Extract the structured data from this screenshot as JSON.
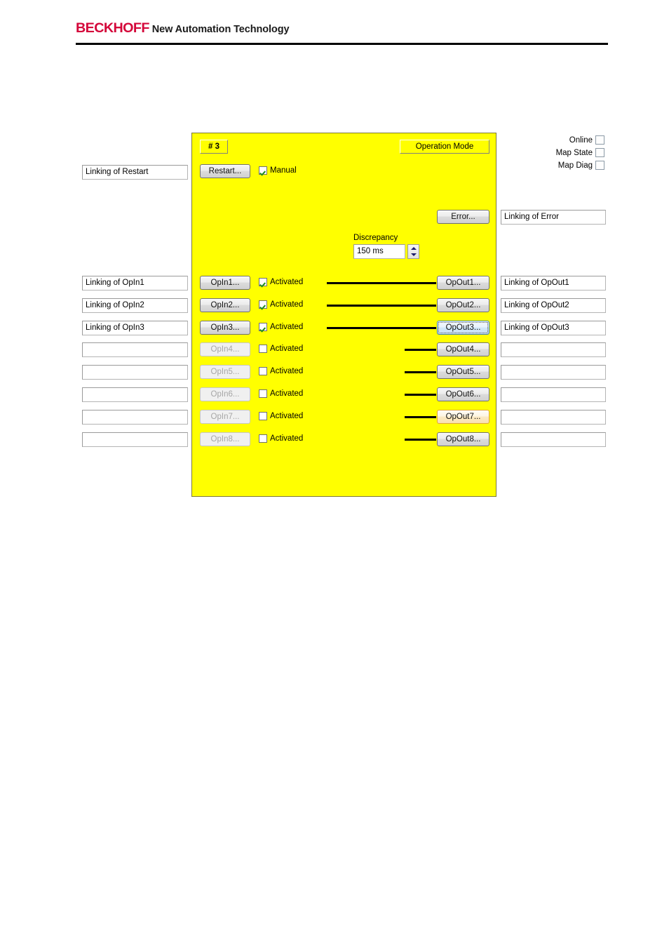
{
  "header": {
    "logo": "BECKHOFF",
    "tagline": "New Automation Technology"
  },
  "panel": {
    "index_tag": "# 3",
    "operation_mode_label": "Operation Mode",
    "restart_button": "Restart...",
    "manual_checkbox_label": "Manual",
    "manual_checked": true,
    "error_button": "Error...",
    "discrepancy_label": "Discrepancy",
    "discrepancy_value": "150 ms",
    "background_color": "#ffff00",
    "border_color": "#7d7a36"
  },
  "status_flags": [
    {
      "label": "Online",
      "checked": false
    },
    {
      "label": "Map State",
      "checked": false
    },
    {
      "label": "Map Diag",
      "checked": false
    }
  ],
  "links": {
    "restart": "Linking of Restart",
    "error": "Linking of Error"
  },
  "rows": [
    {
      "in_link": "Linking of OpIn1",
      "in_button": "OpIn1...",
      "in_enabled": true,
      "activated_label": "Activated",
      "activated": true,
      "connector": "long",
      "out_button": "OpOut1...",
      "out_state": "normal",
      "out_link": "Linking of OpOut1"
    },
    {
      "in_link": "Linking of OpIn2",
      "in_button": "OpIn2...",
      "in_enabled": true,
      "activated_label": "Activated",
      "activated": true,
      "connector": "long",
      "out_button": "OpOut2...",
      "out_state": "normal",
      "out_link": "Linking of OpOut2"
    },
    {
      "in_link": "Linking of OpIn3",
      "in_button": "OpIn3...",
      "in_enabled": true,
      "activated_label": "Activated",
      "activated": true,
      "connector": "long",
      "out_button": "OpOut3...",
      "out_state": "focused",
      "out_link": "Linking of OpOut3"
    },
    {
      "in_link": "",
      "in_button": "OpIn4...",
      "in_enabled": false,
      "activated_label": "Activated",
      "activated": false,
      "connector": "short",
      "out_button": "OpOut4...",
      "out_state": "normal",
      "out_link": ""
    },
    {
      "in_link": "",
      "in_button": "OpIn5...",
      "in_enabled": false,
      "activated_label": "Activated",
      "activated": false,
      "connector": "short",
      "out_button": "OpOut5...",
      "out_state": "normal",
      "out_link": ""
    },
    {
      "in_link": "",
      "in_button": "OpIn6...",
      "in_enabled": false,
      "activated_label": "Activated",
      "activated": false,
      "connector": "short",
      "out_button": "OpOut6...",
      "out_state": "normal",
      "out_link": ""
    },
    {
      "in_link": "",
      "in_button": "OpIn7...",
      "in_enabled": false,
      "activated_label": "Activated",
      "activated": false,
      "connector": "short",
      "out_button": "OpOut7...",
      "out_state": "hover",
      "out_link": ""
    },
    {
      "in_link": "",
      "in_button": "OpIn8...",
      "in_enabled": false,
      "activated_label": "Activated",
      "activated": false,
      "connector": "short",
      "out_button": "OpOut8...",
      "out_state": "normal",
      "out_link": ""
    }
  ]
}
